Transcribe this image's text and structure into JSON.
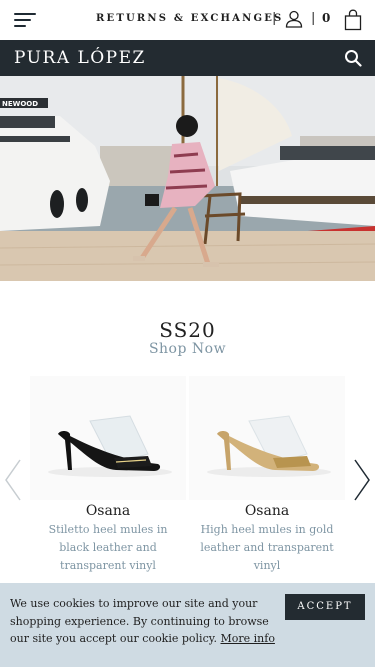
{
  "header": {
    "returns_label": "RETURNS & EXCHANGES",
    "separator": "|",
    "cart_count": "0",
    "icons": {
      "menu": "hamburger-menu-icon",
      "user": "user-icon",
      "bag": "shopping-bag-icon",
      "search": "search-icon"
    }
  },
  "brand": {
    "name": "PURA LÓPEZ"
  },
  "hero": {
    "boat_sign": "NEWOOD"
  },
  "collection": {
    "season": "SS20",
    "cta": "Shop Now",
    "products": [
      {
        "name": "Osana",
        "description": "Stiletto heel mules in black leather and transparent vinyl"
      },
      {
        "name": "Osana",
        "description": "High heel mules in gold leather and transparent vinyl"
      }
    ],
    "icons": {
      "prev": "chevron-left-icon",
      "next": "chevron-right-icon"
    }
  },
  "cookie": {
    "message": "We use cookies to improve our site and your shopping experience. By continuing to browse our site you accept our cookie policy.",
    "link": "More info",
    "accept_label": "ACCEPT"
  },
  "colors": {
    "brand_bar": "#232b31",
    "accent_text": "#7e95a3",
    "cookie_bg": "#cfdbe3"
  }
}
